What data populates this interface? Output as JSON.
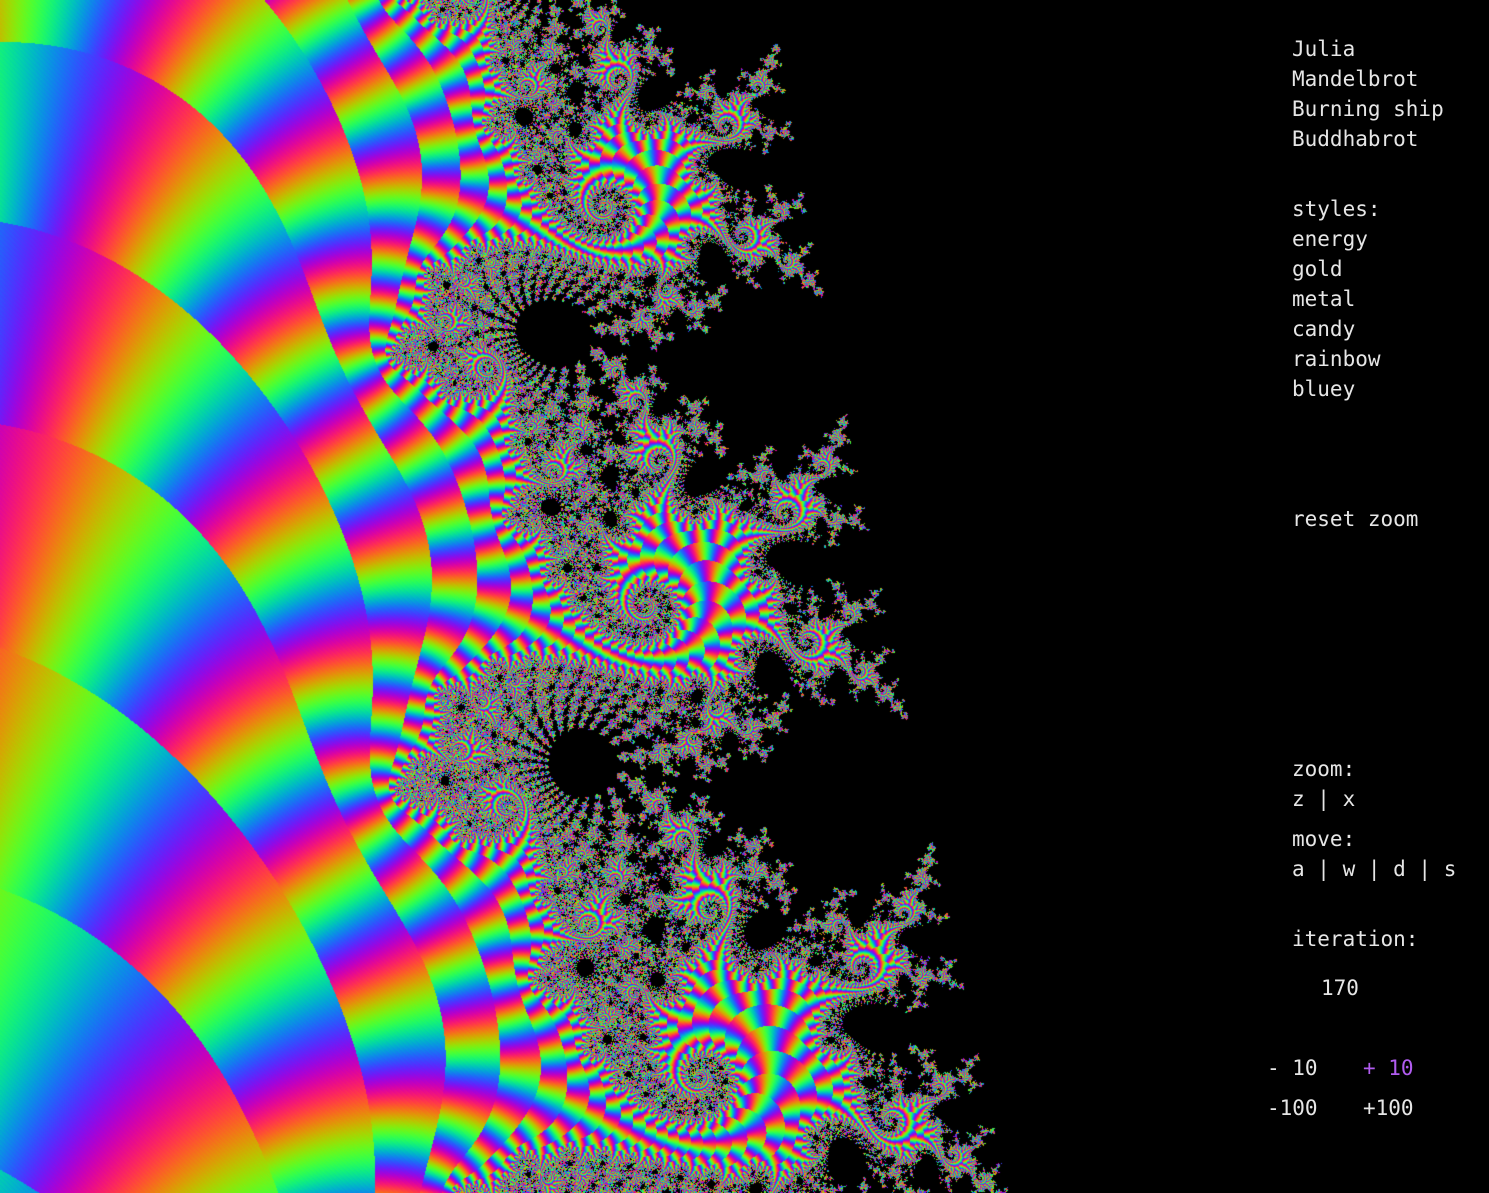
{
  "fractals": [
    "Julia",
    "Mandelbrot",
    "Burning ship",
    "Buddhabrot"
  ],
  "styles_label": "styles:",
  "styles": [
    "energy",
    "gold",
    "metal",
    "candy",
    "rainbow",
    "bluey"
  ],
  "reset_zoom": "reset zoom",
  "zoom_label": "zoom:",
  "zoom_keys": "z | x",
  "move_label": "move:",
  "move_keys": "a | w | d | s",
  "iteration_label": "iteration:",
  "iteration_value": "170",
  "iter_minus_10": "- 10",
  "iter_plus_10": "+ 10",
  "iter_minus_100": "-100",
  "iter_plus_100": "+100",
  "colors": {
    "background": "#000000",
    "text": "#e6e6e6",
    "accent": "#b15cf0"
  }
}
